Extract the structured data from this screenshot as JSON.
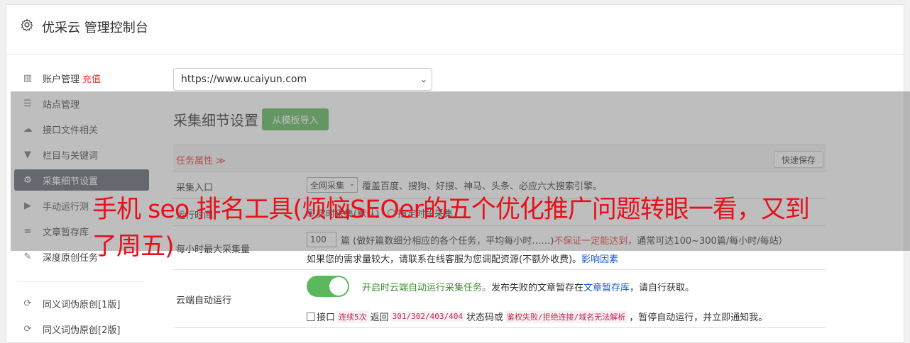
{
  "header": {
    "title": "优采云 管理控制台"
  },
  "sidebar": {
    "items": [
      {
        "icon": "bar-chart-icon",
        "glyph": "▥",
        "label": "账户管理",
        "extra": "充值"
      },
      {
        "icon": "server-icon",
        "glyph": "☰",
        "label": "站点管理"
      },
      {
        "icon": "cloud-upload-icon",
        "glyph": "☁",
        "label": "接口文件相关"
      },
      {
        "icon": "filter-icon",
        "glyph": "▼",
        "label": "栏目与关键词"
      },
      {
        "icon": "gears-icon",
        "glyph": "⚙",
        "label": "采集细节设置"
      },
      {
        "icon": "play-circle-icon",
        "glyph": "▶",
        "label": "手动运行测"
      },
      {
        "icon": "database-icon",
        "glyph": "≡",
        "label": "文章暂存库"
      },
      {
        "icon": "edit-icon",
        "glyph": "✎",
        "label": "深度原创任务"
      },
      {
        "icon": "refresh-icon",
        "glyph": "⟳",
        "label": "同义词伪原创[1版]"
      },
      {
        "icon": "refresh-icon",
        "glyph": "⟳",
        "label": "同义词伪原创[2版]"
      }
    ]
  },
  "main": {
    "site_url": "https://www.ucaiyun.com",
    "section_title": "采集细节设置",
    "template_button": "从模板导入",
    "task_attr": "任务属性 ≫",
    "quick_save": "快速保存",
    "collect_entry": {
      "label": "采集入口",
      "select_value": "全网采集",
      "desc": "覆盖百度、搜狗、好搜、神马、头条、必应六大搜索引擎。"
    },
    "run_time": {
      "label": "运行时间",
      "option_default": "实时采集(默认)",
      "option_scheduled": "指定时段采集"
    },
    "hourly": {
      "label": "每小时最大采集量",
      "value": "100",
      "desc_main": "篇 (做好篇数细分相应的各个任务，平均每小时……)",
      "desc_red": "不保证一定能达到",
      "desc_tail": "，通常可达100~300篇/每小时/每站）",
      "desc_line2": "如果您的需求量较大，请联系在线客服为您调配资源(不额外收费)。",
      "link": "影响因素"
    },
    "cloud_run": {
      "label": "云端自动运行",
      "enabled_text": "开启时云端自动运行采集任务。",
      "desc": "发布失败的文章暂存在",
      "link": "文章暂存库",
      "desc_tail": "，请自行获取。",
      "cb_prefix": "接口",
      "code1": "连续5次",
      "mid1": "返回",
      "code2": "301/302/403/404",
      "mid2": "状态码或",
      "code3": "鉴权失败/拒绝连接/域名无法解析",
      "tail": "，暂停自动运行，并立即通知我。"
    }
  },
  "overlay": {
    "headline": "手机 seo 排名工具(烦恼SEOer的五个优化推广问题转眼一看，又到了周五)"
  }
}
